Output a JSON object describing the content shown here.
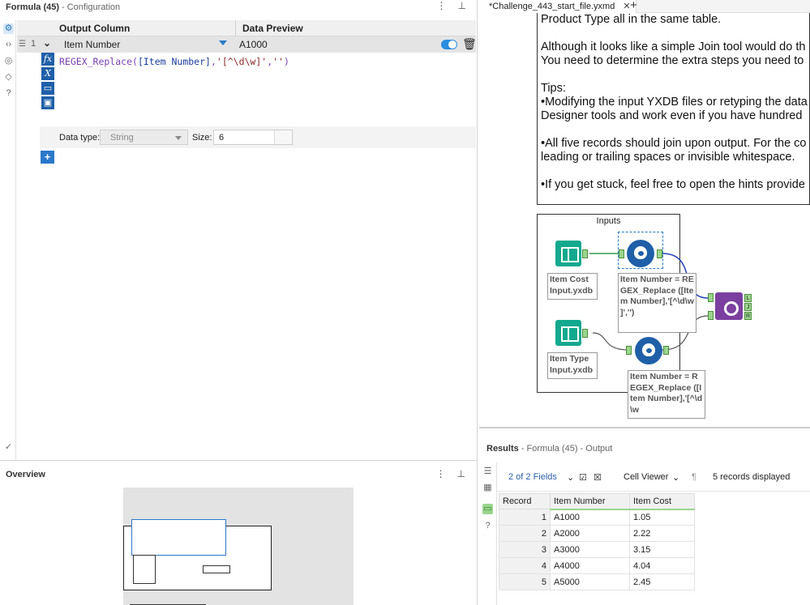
{
  "config": {
    "title": "Formula (45)",
    "subtitle": "- Configuration",
    "columns": [
      "Output Column",
      "Data Preview"
    ],
    "row": {
      "index": "1",
      "output_column": "Item Number",
      "preview": "A1000",
      "enabled": true
    },
    "expression": {
      "func": "REGEX_Replace(",
      "field": "[Item Number]",
      "sep1": ",",
      "pattern": "'[^\\d\\w]'",
      "sep2": ",",
      "replacement": "''",
      "close": ")"
    },
    "data_type_label": "Data type:",
    "data_type_value": "String",
    "size_label": "Size:",
    "size_value": "6"
  },
  "overview": {
    "title": "Overview"
  },
  "workflow": {
    "tab_label": "*Challenge_443_start_file.yxmd",
    "comment_lines": [
      "Product Type all in the same table.",
      "",
      "Although it looks like a simple Join tool would do th",
      "You need to determine the extra steps you need to",
      "",
      "Tips:",
      "•Modifying the input YXDB files or retyping the data",
      "Designer tools and work even if you have hundred",
      "",
      "•All five records should join upon output. For the co",
      "leading or trailing spaces or invisible whitespace.",
      "",
      "•If you get stuck, feel free to open the hints provide"
    ],
    "container_title": "Inputs",
    "input1_label": "Item Cost Input.yxdb",
    "input2_label": "Item Type Input.yxdb",
    "formula1_anno": "Item Number = REGEX_Replace ([Item Number],'[^\\d\\w ]','')",
    "formula2_anno": "Item Number = REGEX_Replace ([Item Number],'[^\\d\\w",
    "join_anchors": [
      "L",
      "J",
      "R"
    ]
  },
  "results": {
    "title": "Results",
    "subtitle": "- Formula (45) - Output",
    "fields_label": "2 of 2 Fields",
    "viewer_label": "Cell Viewer",
    "records_label": "5 records displayed",
    "headers": [
      "Record",
      "Item Number",
      "Item Cost"
    ],
    "rows": [
      [
        "1",
        "A1000",
        "1.05"
      ],
      [
        "2",
        "A2000",
        "2.22"
      ],
      [
        "3",
        "A3000",
        "3.15"
      ],
      [
        "4",
        "A4000",
        "4.04"
      ],
      [
        "5",
        "A5000",
        "2.45"
      ]
    ]
  },
  "colors": {
    "accent": "#2a78c9",
    "input_tool": "#13a98e",
    "formula_tool": "#1f5fa8",
    "join_tool": "#7b3fa0"
  }
}
